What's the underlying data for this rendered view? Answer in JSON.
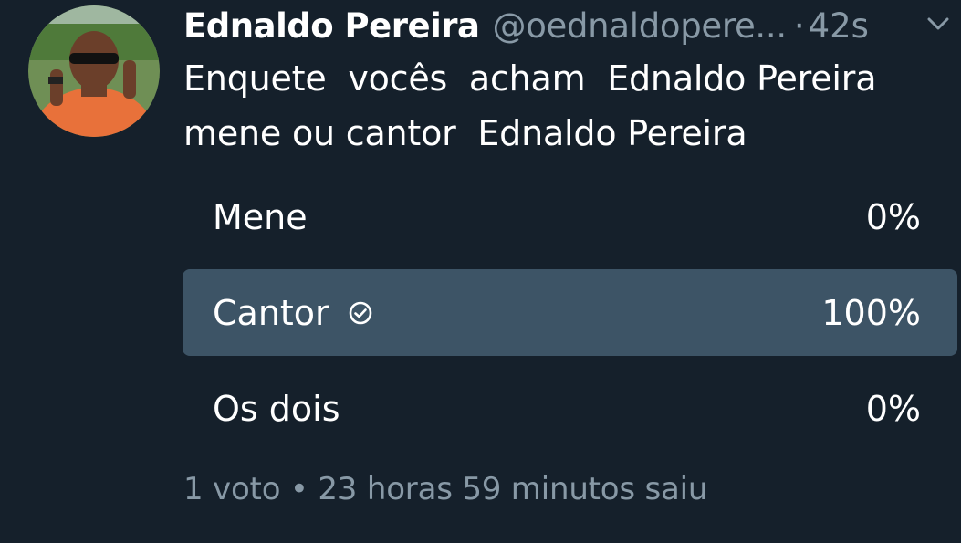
{
  "tweet": {
    "display_name": "Ednaldo Pereira",
    "handle": "@oednaldopere...",
    "separator": "·",
    "time": "42s",
    "text": "Enquete  vocês  acham  Ednaldo Pereira\nmene ou cantor  Ednaldo Pereira",
    "avatar_icon": "profile-photo",
    "menu_icon": "chevron-down-icon"
  },
  "poll": {
    "options": [
      {
        "label": "Mene",
        "percent": "0%",
        "fraction": 0,
        "selected": false
      },
      {
        "label": "Cantor",
        "percent": "100%",
        "fraction": 1,
        "selected": true
      },
      {
        "label": "Os dois",
        "percent": "0%",
        "fraction": 0,
        "selected": false
      }
    ],
    "votes": "1 voto",
    "bullet": "•",
    "status": "23 horas 59 minutos saiu",
    "fill_color": "#3d5466"
  },
  "colors": {
    "background": "#15202b",
    "muted_text": "#8899a6",
    "primary_text": "#ffffff"
  }
}
